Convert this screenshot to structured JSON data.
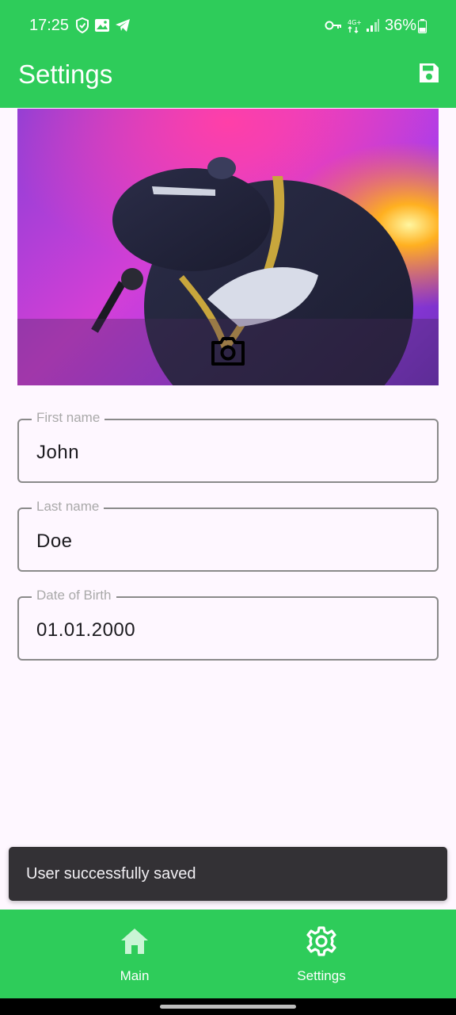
{
  "status_bar": {
    "time": "17:25",
    "battery": "36%",
    "left_icons": [
      "shield-icon",
      "image-icon",
      "telegram-icon"
    ],
    "right_icons": [
      "key-icon",
      "network-4g-icon",
      "signal-icon",
      "battery-icon"
    ]
  },
  "app_bar": {
    "title": "Settings",
    "save_icon": "save-icon"
  },
  "profile_photo": {
    "camera_icon": "camera-icon"
  },
  "form": {
    "first_name": {
      "label": "First name",
      "value": "John"
    },
    "last_name": {
      "label": "Last name",
      "value": "Doe"
    },
    "date_of_birth": {
      "label": "Date of Birth",
      "value": "01.01.2000"
    }
  },
  "snackbar": {
    "message": "User successfully saved"
  },
  "bottom_nav": {
    "items": [
      {
        "label": "Main",
        "icon": "home-icon"
      },
      {
        "label": "Settings",
        "icon": "gear-icon"
      }
    ]
  },
  "colors": {
    "primary": "#2ECC5A",
    "background": "#FEF7FF",
    "snackbar": "#333135",
    "field_border": "#8A8A8A"
  }
}
